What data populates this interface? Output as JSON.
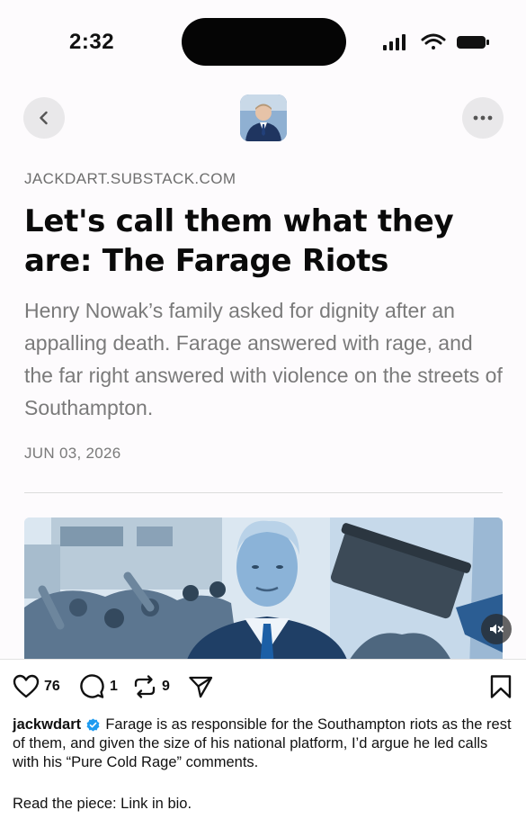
{
  "status_bar": {
    "time": "2:32"
  },
  "article": {
    "source": "JACKDART.SUBSTACK.COM",
    "headline": "Let's call them what they are: The Farage Riots",
    "subtitle": "Henry Nowak’s family asked for dignity after an appalling death. Farage answered with rage, and the far right answered with violence on the streets of Southampton.",
    "date": "JUN 03, 2026"
  },
  "post": {
    "likes": "76",
    "comments": "1",
    "reposts": "9",
    "username": "jackwdart",
    "caption": "Farage is as responsible for the Southampton riots as the rest of them, and given the size of his national platform, I’d argue he led calls with his “Pure Cold Rage” comments.",
    "caption_link_line": "Read the piece: Link in bio."
  },
  "icons": {
    "back": "chevron-left-icon",
    "more": "more-horizontal-icon",
    "mute": "speaker-muted-icon",
    "like": "heart-icon",
    "comment": "comment-bubble-icon",
    "repost": "repost-icon",
    "share": "send-icon",
    "bookmark": "bookmark-icon",
    "verified": "verified-badge-icon"
  },
  "colors": {
    "verified": "#1d9bf0",
    "headline": "#0a0a0a",
    "muted_text": "#7a7a7a"
  }
}
